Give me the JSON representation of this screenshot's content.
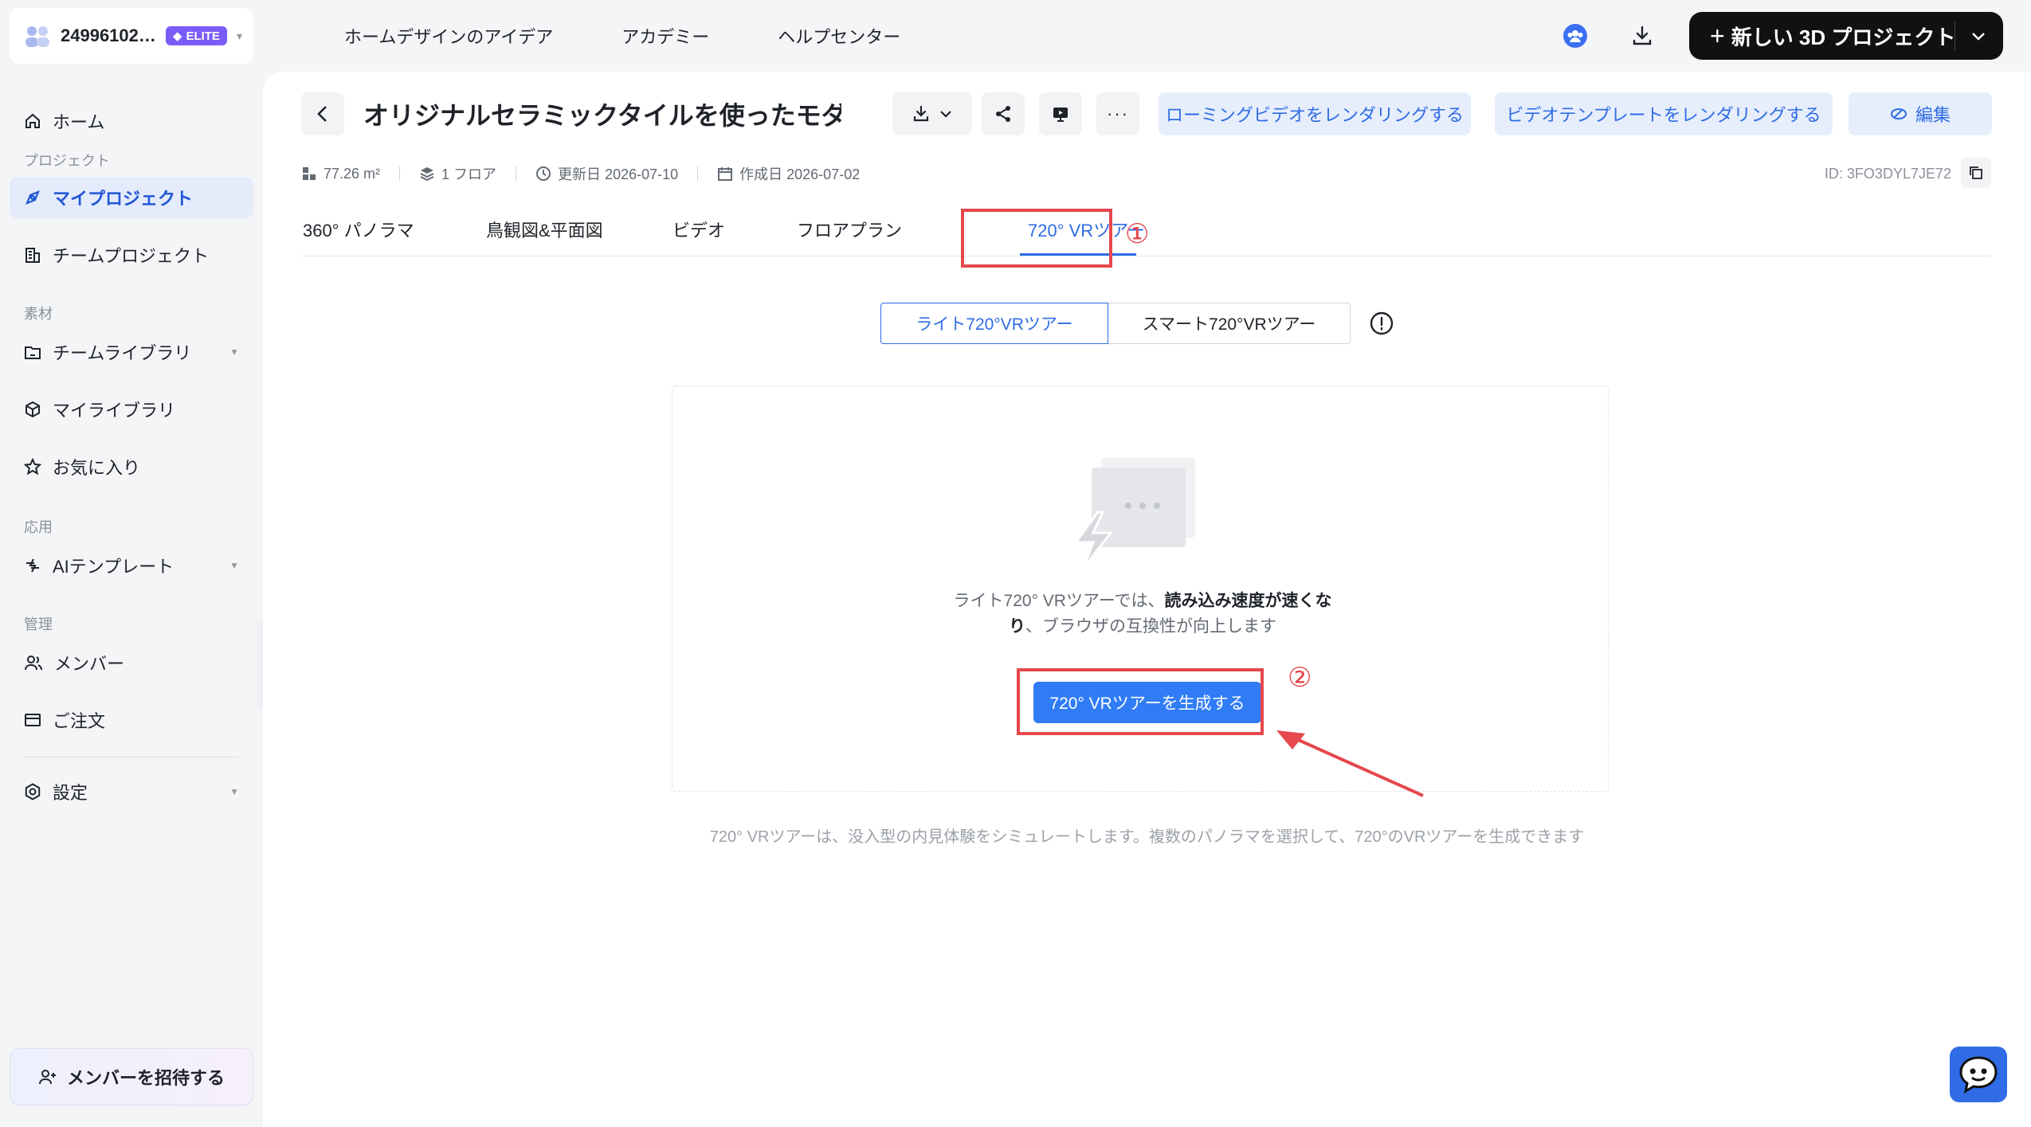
{
  "team": {
    "name": "24996102…",
    "badge": "ELITE"
  },
  "top_nav": [
    "ホームデザインのアイデア",
    "アカデミー",
    "ヘルプセンター"
  ],
  "new_project": {
    "label": "新しい 3D プロジェクト"
  },
  "sidebar": {
    "home": "ホーム",
    "section_project": "プロジェクト",
    "my_projects": "マイプロジェクト",
    "team_projects": "チームプロジェクト",
    "section_materials": "素材",
    "team_library": "チームライブラリ",
    "my_library": "マイライブラリ",
    "favorites": "お気に入り",
    "section_apps": "応用",
    "ai_templates": "AIテンプレート",
    "section_manage": "管理",
    "members": "メンバー",
    "orders": "ご注文",
    "settings": "設定",
    "invite": "メンバーを招待する"
  },
  "project": {
    "title": "オリジナルセラミックタイルを使ったモダ…",
    "area": "77.26 m²",
    "floors": "1 フロア",
    "updated": "更新日 2026-07-10",
    "created": "作成日 2026-07-02",
    "id": "ID: 3FO3DYL7JE72"
  },
  "actions": {
    "roaming_video": "ローミングビデオをレンダリングする",
    "video_template": "ビデオテンプレートをレンダリングする",
    "edit": "編集"
  },
  "tabs": [
    "360° パノラマ",
    "鳥観図&平面図",
    "ビデオ",
    "フロアプラン",
    "720° VRツアー"
  ],
  "annotations": {
    "one": "①",
    "two": "②"
  },
  "segments": {
    "lite": "ライト720°VRツアー",
    "smart": "スマート720°VRツアー"
  },
  "empty": {
    "text_prefix": "ライト720° VRツアーでは、",
    "text_bold": "読み込み速度が速くなり",
    "text_suffix": "、ブラウザの互換性が向上します",
    "button": "720° VRツアーを生成する"
  },
  "footnote": "720° VRツアーは、没入型の内見体験をシミュレートします。複数のパノラマを選択して、720°のVRツアーを生成できます",
  "colors": {
    "accent": "#2f6ce5",
    "annotation": "#e5484d",
    "elite": "#7a5cf6"
  }
}
